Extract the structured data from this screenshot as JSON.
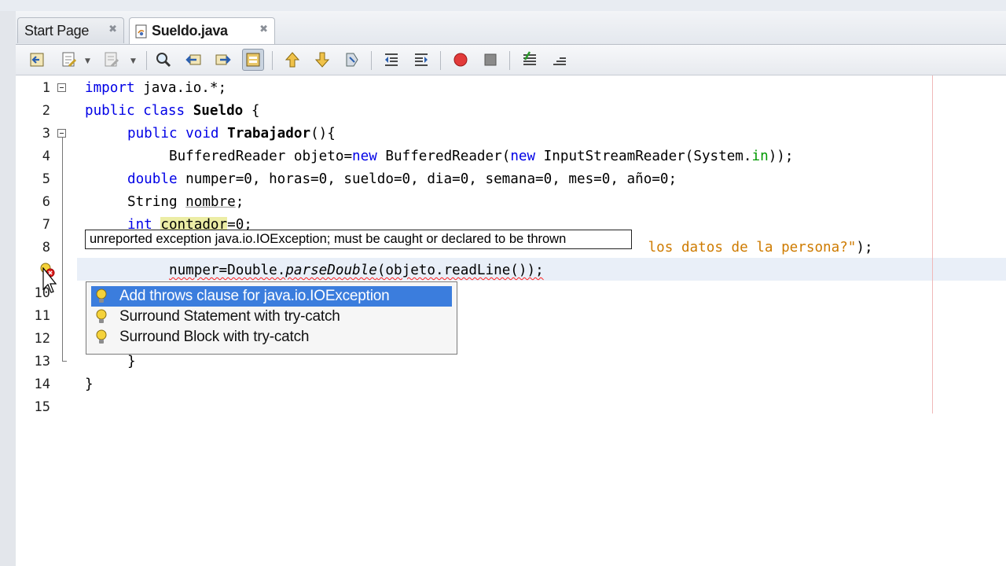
{
  "tabs": [
    {
      "label": "Start Page",
      "close": "✖"
    },
    {
      "label": "Sueldo.java",
      "close": "✖"
    }
  ],
  "toolbar": {
    "icons": [
      "back-icon",
      "last-edit-icon",
      "forward-icon",
      "find-icon",
      "find-previous-icon",
      "find-next-icon",
      "toggle-highlight-icon",
      "previous-bookmark-icon",
      "next-bookmark-icon",
      "toggle-bookmark-icon",
      "shift-left-icon",
      "shift-right-icon",
      "start-macro-icon",
      "stop-macro-icon",
      "comment-icon",
      "uncomment-icon"
    ]
  },
  "line_numbers": [
    "1",
    "2",
    "3",
    "4",
    "5",
    "6",
    "7",
    "8",
    "9",
    "10",
    "11",
    "12",
    "13",
    "14",
    "15"
  ],
  "code": {
    "l1": {
      "kw": "import",
      "rest": " java.io.*;"
    },
    "l2": {
      "kw": "public class",
      "name": "Sueldo",
      "rest": " {"
    },
    "l3": {
      "kw": "public void",
      "name": "Trabajador",
      "rest": "(){"
    },
    "l4": {
      "a": "BufferedReader objeto=",
      "kw1": "new",
      "b": " BufferedReader(",
      "kw2": "new",
      "c": " InputStreamReader(System.",
      "field": "in",
      "d": "));"
    },
    "l5": {
      "kw": "double",
      "rest": " numper=0, horas=0, sueldo=0, dia=0, semana=0, mes=0, año=0;"
    },
    "l6": {
      "a": "String ",
      "var": "nombre",
      "b": ";"
    },
    "l7": {
      "kw": "int",
      "sp": " ",
      "var": "contador",
      "b": "=0;"
    },
    "l8": {
      "str": " los datos de la persona?\"",
      "b": ");"
    },
    "l9": {
      "a": "numper=Double.",
      "method": "parseDouble",
      "b": "(objeto.readLine());"
    },
    "l13": {
      "a": "}"
    },
    "l14": {
      "a": "}"
    }
  },
  "tooltip": {
    "text": "unreported exception java.io.IOException; must be caught or declared to be thrown"
  },
  "hints": [
    {
      "label": "Add throws clause for java.io.IOException",
      "selected": true
    },
    {
      "label": "Surround Statement with try-catch",
      "selected": false
    },
    {
      "label": "Surround Block with try-catch",
      "selected": false
    }
  ],
  "colors": {
    "keyword": "#0000e6",
    "string": "#ce7b00",
    "selection": "#3b7ddd",
    "error": "#ff2020"
  }
}
